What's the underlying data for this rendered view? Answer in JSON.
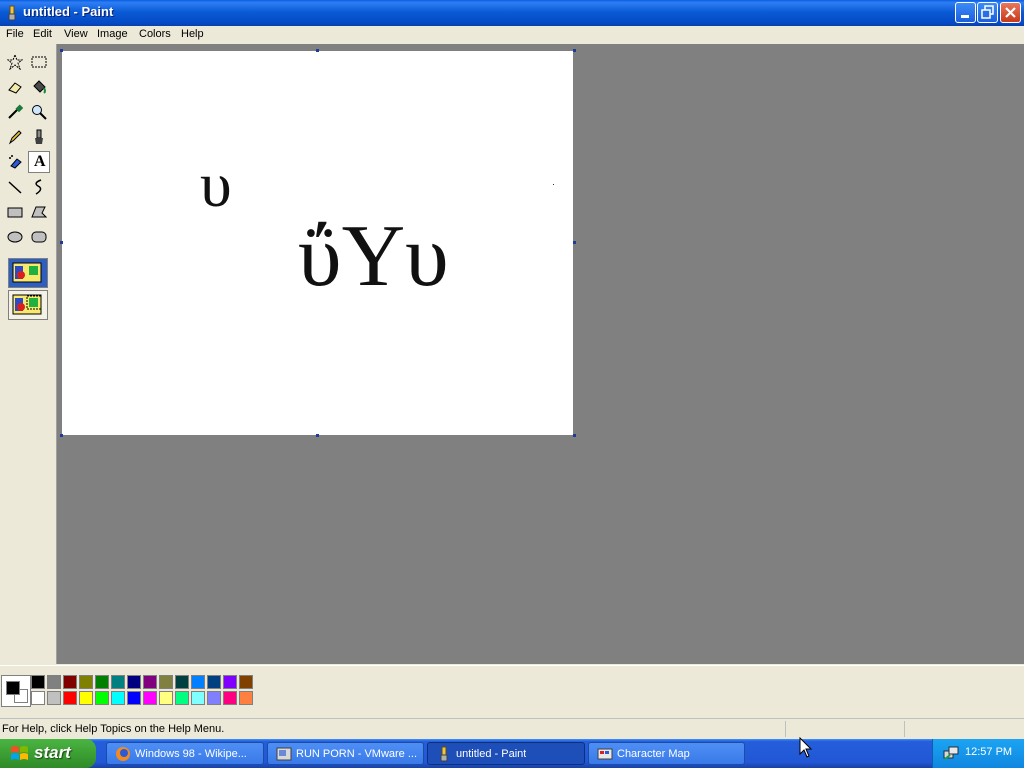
{
  "window": {
    "title": "untitled - Paint",
    "icon": "paint-app-icon",
    "controls": [
      "minimize",
      "maximize",
      "close"
    ]
  },
  "menu": [
    "File",
    "Edit",
    "View",
    "Image",
    "Colors",
    "Help"
  ],
  "tools": [
    {
      "name": "free-form-select",
      "icon": "star-select-icon"
    },
    {
      "name": "select",
      "icon": "rect-select-icon"
    },
    {
      "name": "eraser",
      "icon": "eraser-icon"
    },
    {
      "name": "fill",
      "icon": "fill-bucket-icon"
    },
    {
      "name": "pick-color",
      "icon": "eyedropper-icon"
    },
    {
      "name": "magnifier",
      "icon": "magnifier-icon"
    },
    {
      "name": "pencil",
      "icon": "pencil-icon"
    },
    {
      "name": "brush",
      "icon": "brush-icon"
    },
    {
      "name": "airbrush",
      "icon": "airbrush-icon"
    },
    {
      "name": "text",
      "icon": "text-icon",
      "label": "A",
      "selected": true
    },
    {
      "name": "line",
      "icon": "line-icon"
    },
    {
      "name": "curve",
      "icon": "curve-icon"
    },
    {
      "name": "rectangle",
      "icon": "rectangle-icon"
    },
    {
      "name": "polygon",
      "icon": "polygon-icon"
    },
    {
      "name": "ellipse",
      "icon": "ellipse-icon"
    },
    {
      "name": "rounded-rectangle",
      "icon": "rounded-rect-icon"
    }
  ],
  "canvas": {
    "text_small": "υ",
    "text_large": "ΰΥυ"
  },
  "palette": {
    "foreground": "#000000",
    "background": "#ffffff",
    "row1": [
      "#000000",
      "#808080",
      "#800000",
      "#808000",
      "#008000",
      "#008080",
      "#000080",
      "#800080",
      "#808040",
      "#004040",
      "#0080ff",
      "#004080",
      "#8000ff",
      "#804000"
    ],
    "row2": [
      "#ffffff",
      "#c0c0c0",
      "#ff0000",
      "#ffff00",
      "#00ff00",
      "#00ffff",
      "#0000ff",
      "#ff00ff",
      "#ffff80",
      "#00ff80",
      "#80ffff",
      "#8080ff",
      "#ff0080",
      "#ff8040"
    ]
  },
  "status": {
    "help_text": "For Help, click Help Topics on the Help Menu."
  },
  "taskbar": {
    "start_label": "start",
    "tasks": [
      {
        "label": "Windows 98 - Wikipe...",
        "icon": "firefox-icon"
      },
      {
        "label": "RUN PORN - VMware ...",
        "icon": "vmware-icon"
      },
      {
        "label": "untitled - Paint",
        "icon": "paint-app-icon",
        "active": true
      },
      {
        "label": "Character Map",
        "icon": "charmap-icon"
      }
    ],
    "clock": "12:57 PM"
  }
}
